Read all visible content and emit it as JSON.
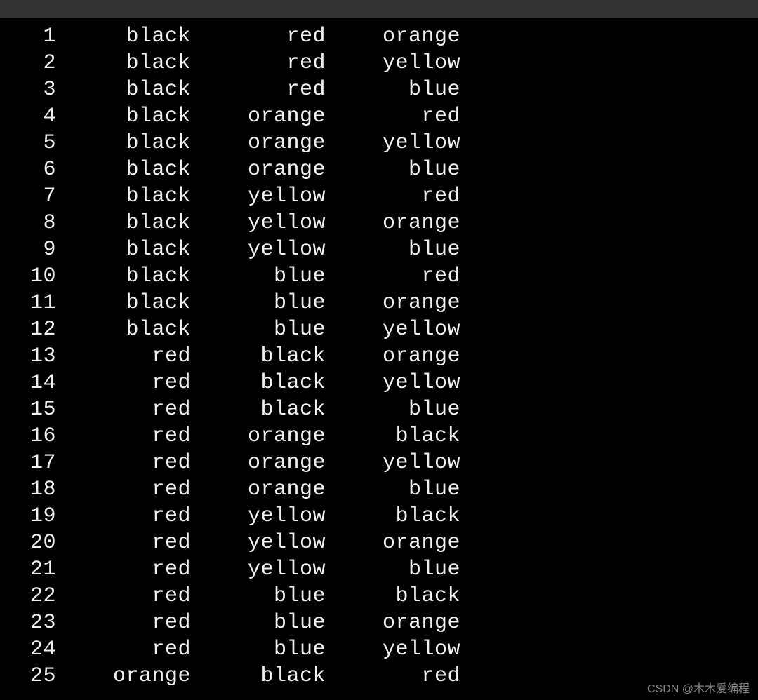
{
  "terminal": {
    "rows": [
      {
        "n": "1",
        "c1": "black",
        "c2": "red",
        "c3": "orange"
      },
      {
        "n": "2",
        "c1": "black",
        "c2": "red",
        "c3": "yellow"
      },
      {
        "n": "3",
        "c1": "black",
        "c2": "red",
        "c3": "blue"
      },
      {
        "n": "4",
        "c1": "black",
        "c2": "orange",
        "c3": "red"
      },
      {
        "n": "5",
        "c1": "black",
        "c2": "orange",
        "c3": "yellow"
      },
      {
        "n": "6",
        "c1": "black",
        "c2": "orange",
        "c3": "blue"
      },
      {
        "n": "7",
        "c1": "black",
        "c2": "yellow",
        "c3": "red"
      },
      {
        "n": "8",
        "c1": "black",
        "c2": "yellow",
        "c3": "orange"
      },
      {
        "n": "9",
        "c1": "black",
        "c2": "yellow",
        "c3": "blue"
      },
      {
        "n": "10",
        "c1": "black",
        "c2": "blue",
        "c3": "red"
      },
      {
        "n": "11",
        "c1": "black",
        "c2": "blue",
        "c3": "orange"
      },
      {
        "n": "12",
        "c1": "black",
        "c2": "blue",
        "c3": "yellow"
      },
      {
        "n": "13",
        "c1": "red",
        "c2": "black",
        "c3": "orange"
      },
      {
        "n": "14",
        "c1": "red",
        "c2": "black",
        "c3": "yellow"
      },
      {
        "n": "15",
        "c1": "red",
        "c2": "black",
        "c3": "blue"
      },
      {
        "n": "16",
        "c1": "red",
        "c2": "orange",
        "c3": "black"
      },
      {
        "n": "17",
        "c1": "red",
        "c2": "orange",
        "c3": "yellow"
      },
      {
        "n": "18",
        "c1": "red",
        "c2": "orange",
        "c3": "blue"
      },
      {
        "n": "19",
        "c1": "red",
        "c2": "yellow",
        "c3": "black"
      },
      {
        "n": "20",
        "c1": "red",
        "c2": "yellow",
        "c3": "orange"
      },
      {
        "n": "21",
        "c1": "red",
        "c2": "yellow",
        "c3": "blue"
      },
      {
        "n": "22",
        "c1": "red",
        "c2": "blue",
        "c3": "black"
      },
      {
        "n": "23",
        "c1": "red",
        "c2": "blue",
        "c3": "orange"
      },
      {
        "n": "24",
        "c1": "red",
        "c2": "blue",
        "c3": "yellow"
      },
      {
        "n": "25",
        "c1": "orange",
        "c2": "black",
        "c3": "red"
      }
    ]
  },
  "watermark": "CSDN @木木爱编程"
}
